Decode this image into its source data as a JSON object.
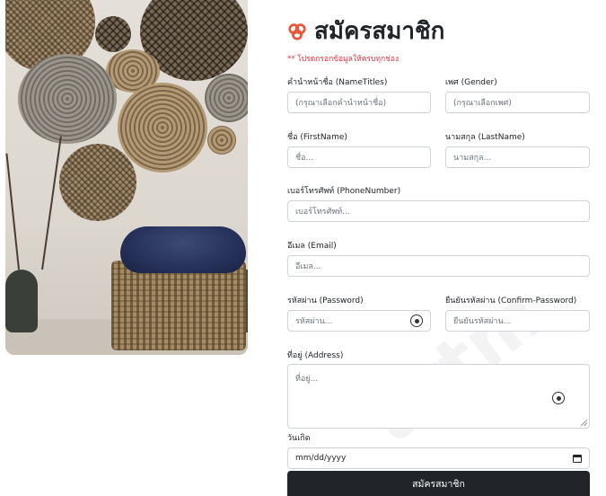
{
  "form": {
    "title": "สมัครสมาชิก",
    "logo_icon": "chain-link-icon",
    "accent_color": "#e8573a",
    "required_note": "** โปรดกรอกข้อมูลให้ครบทุกช่อง",
    "name_titles": {
      "label": "คำนำหน้าชื่อ (NameTitles)",
      "value": "(กรุณาเลือกคำนำหน้าชื่อ)"
    },
    "gender": {
      "label": "เพศ (Gender)",
      "value": "(กรุณาเลือกเพศ)"
    },
    "first_name": {
      "label": "ชื่อ (FirstName)",
      "placeholder": "ชื่อ..."
    },
    "last_name": {
      "label": "นามสกุล (LastName)",
      "placeholder": "นามสกุล..."
    },
    "phone": {
      "label": "เบอร์โทรศัพท์ (PhoneNumber)",
      "placeholder": "เบอร์โทรศัพท์..."
    },
    "email": {
      "label": "อีเมล (Email)",
      "placeholder": "อีเมล..."
    },
    "password": {
      "label": "รหัสผ่าน (Password)",
      "placeholder": "รหัสผ่าน...",
      "toggle_icon": "eye-icon"
    },
    "confirm_password": {
      "label": "ยืนยันรหัสผ่าน (Confirm-Password)",
      "placeholder": "ยืนยันรหัสผ่าน..."
    },
    "address": {
      "label": "ที่อยู่ (Address)",
      "placeholder": "ที่อยู่..."
    },
    "birthdate": {
      "label": "วันเกิด",
      "placeholder": "mm/dd/yyyy",
      "icon": "calendar-icon"
    },
    "submit_label": "สมัครสมาชิก",
    "submit_color": "#212529"
  },
  "watermark": "artm"
}
